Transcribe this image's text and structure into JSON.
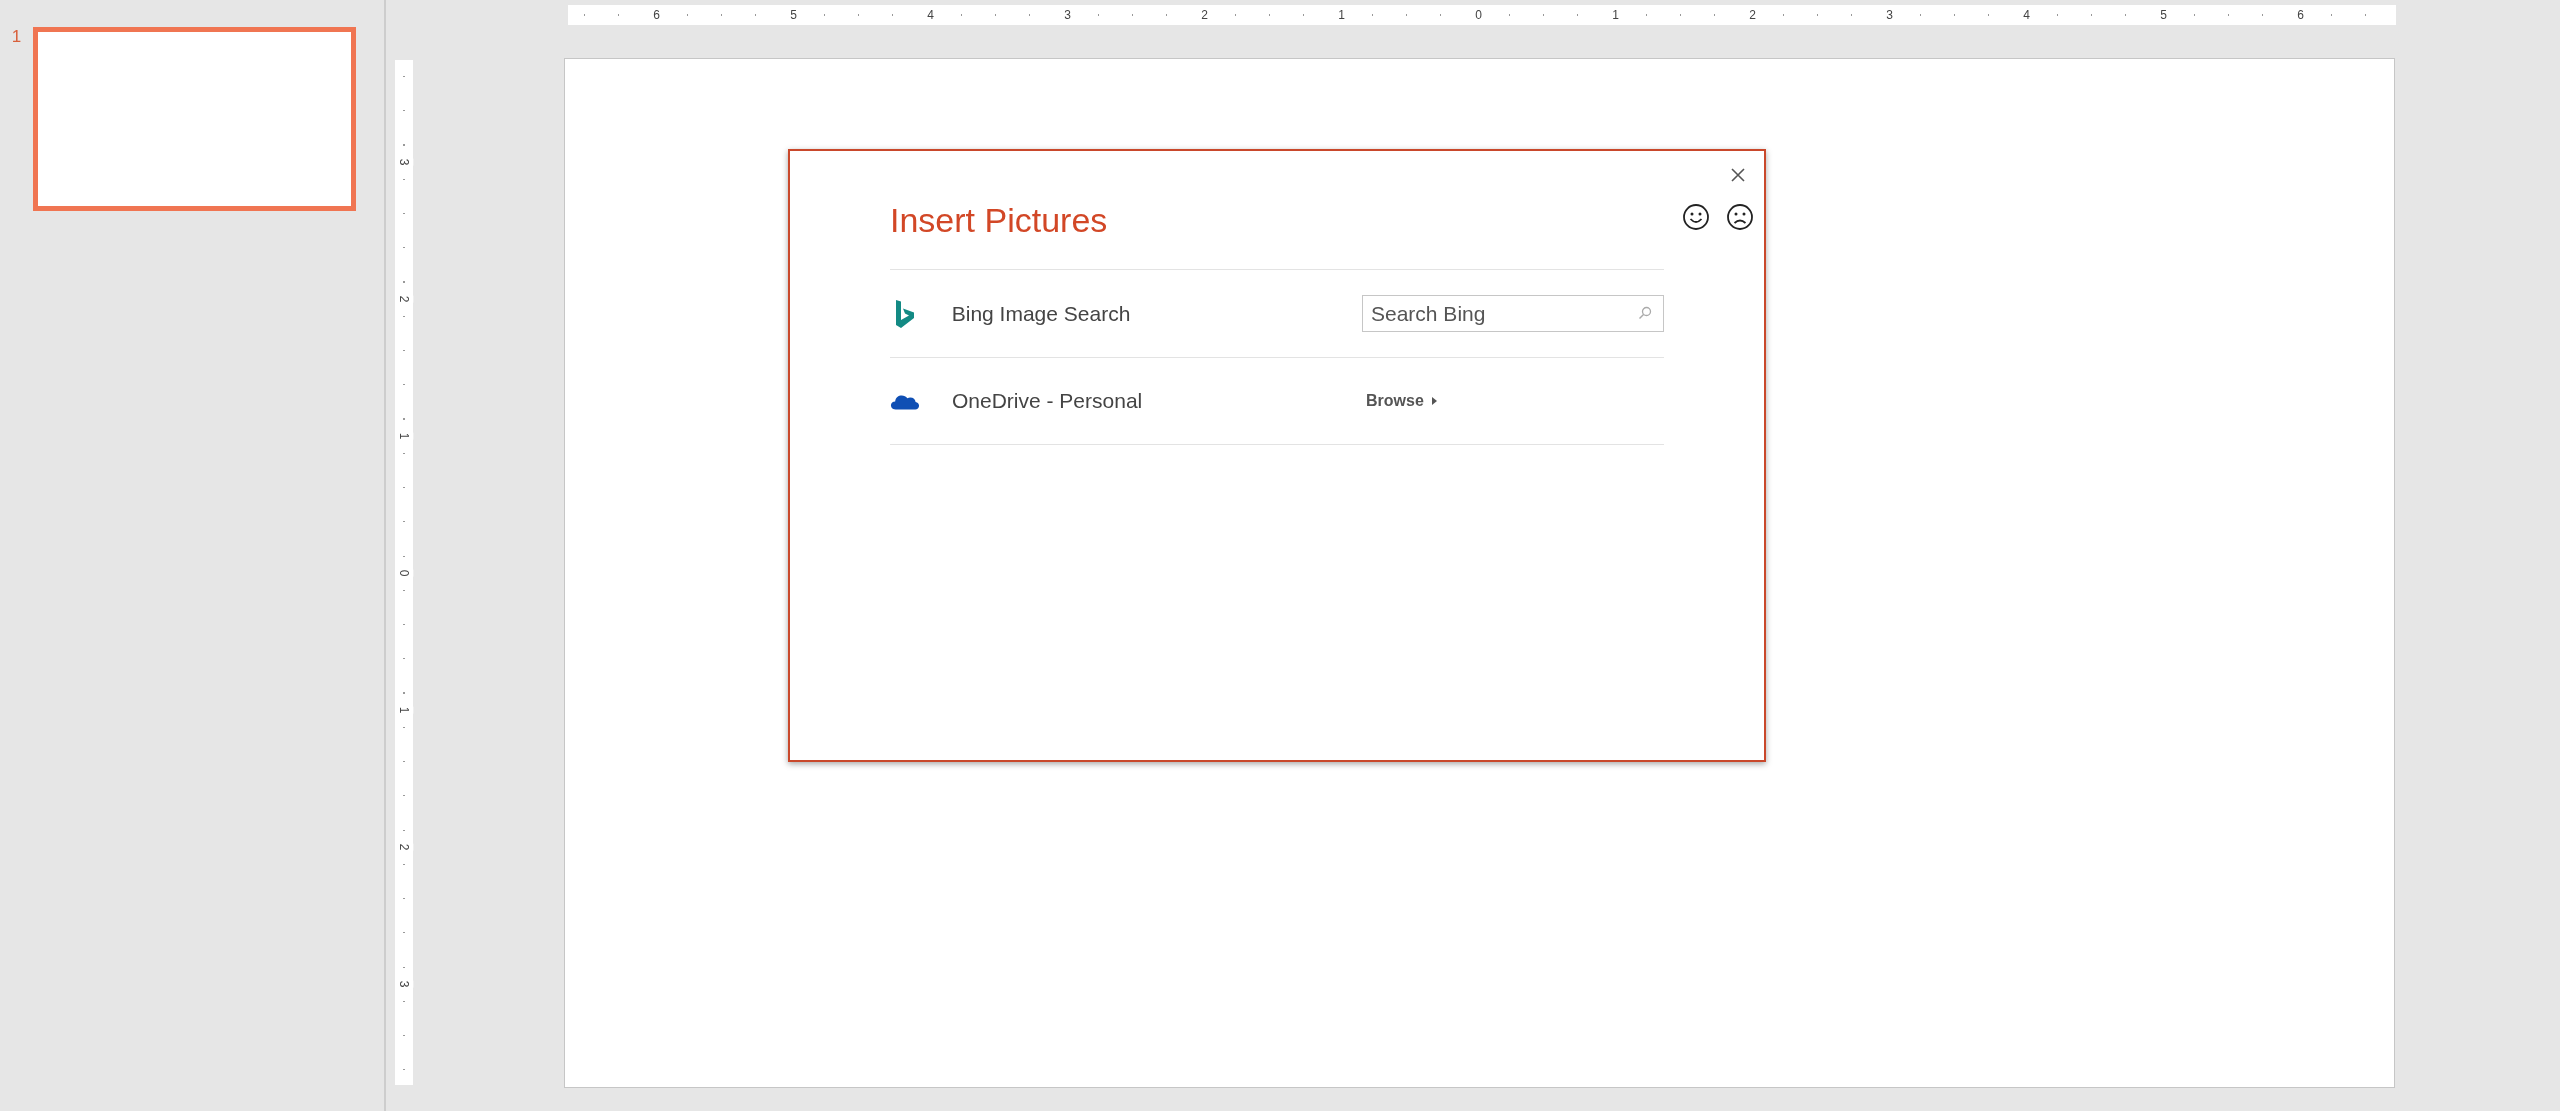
{
  "slides_pane": {
    "slides": [
      {
        "number": "1",
        "selected": true
      }
    ]
  },
  "rulers": {
    "horizontal": [
      "6",
      "5",
      "4",
      "3",
      "2",
      "1",
      "0",
      "1",
      "2",
      "3",
      "4",
      "5",
      "6"
    ],
    "vertical": [
      "3",
      "2",
      "1",
      "0",
      "1",
      "2",
      "3"
    ]
  },
  "dialog": {
    "title": "Insert Pictures",
    "sources": [
      {
        "kind": "search",
        "name": "Bing Image Search",
        "placeholder": "Search Bing"
      },
      {
        "kind": "browse",
        "name": "OneDrive - Personal",
        "action": "Browse"
      }
    ]
  }
}
